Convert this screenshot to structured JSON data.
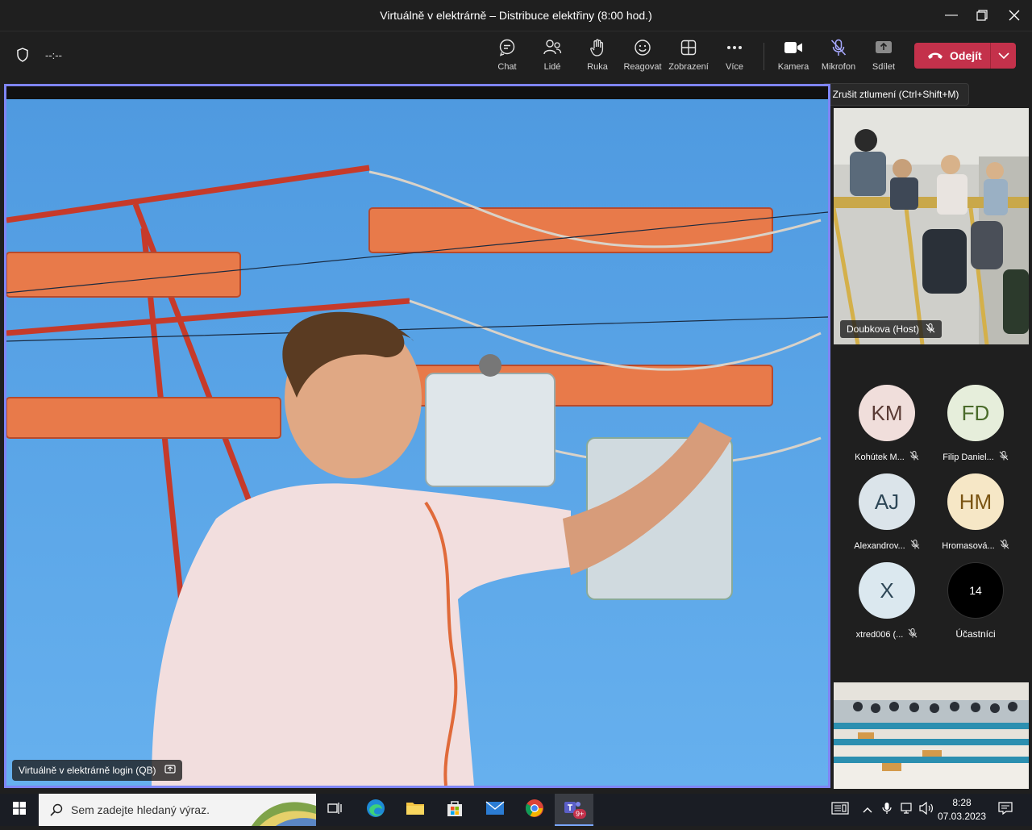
{
  "window": {
    "title": "Virtuálně v elektrárně – Distribuce elektřiny (8:00 hod.)"
  },
  "toolbar": {
    "timer": "--:--",
    "buttons": [
      {
        "label": "Chat",
        "icon": "chat-icon"
      },
      {
        "label": "Lidé",
        "icon": "people-icon"
      },
      {
        "label": "Ruka",
        "icon": "raise-hand-icon"
      },
      {
        "label": "Reagovat",
        "icon": "smiley-icon"
      },
      {
        "label": "Zobrazení",
        "icon": "layout-icon"
      },
      {
        "label": "Více",
        "icon": "more-icon"
      },
      {
        "label": "Kamera",
        "icon": "camera-icon"
      },
      {
        "label": "Mikrofon",
        "icon": "mic-muted-icon"
      },
      {
        "label": "Sdílet",
        "icon": "share-icon"
      }
    ],
    "leave_label": "Odejít",
    "leave_color": "#c4314b"
  },
  "tooltip": "Zrušit ztlumení (Ctrl+Shift+M)",
  "main_video": {
    "name": "Virtuálně v elektrárně login (QB)",
    "border_color": "#7f85f5"
  },
  "tiles": {
    "host": {
      "name": "Doubkova (Host)"
    },
    "participants": [
      {
        "initials": "KM",
        "name": "Kohútek M...",
        "color": "#f0dedb",
        "text": "#5a3b35"
      },
      {
        "initials": "FD",
        "name": "Filip Daniel...",
        "color": "#e6eedb",
        "text": "#4a6b2a"
      },
      {
        "initials": "AJ",
        "name": "Alexandrov...",
        "color": "#dbe4ea",
        "text": "#2d4656"
      },
      {
        "initials": "HM",
        "name": "Hromasová...",
        "color": "#f6e7c6",
        "text": "#7a5412"
      },
      {
        "initials": "X",
        "name": "xtred006 (...",
        "color": "#dbe8ef",
        "text": "#2d4656"
      }
    ],
    "count": {
      "value": "14",
      "label": "Účastníci"
    }
  },
  "taskbar": {
    "search_placeholder": "Sem zadejte hledaný výraz.",
    "teams_badge": "9+",
    "time": "8:28",
    "date": "07.03.2023"
  }
}
